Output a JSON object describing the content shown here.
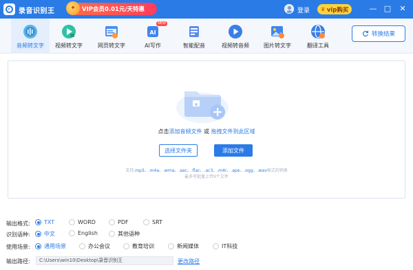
{
  "app": {
    "title": "录音识别王",
    "promo_text": "VIP会员0.01元/天特惠",
    "login": "登录",
    "vip_buy": "vip购买",
    "window_controls": [
      "—",
      "□",
      "✕"
    ]
  },
  "toolbar": {
    "tools": [
      {
        "label": "音频转文字",
        "icon": "audio-to-text-icon",
        "active": true
      },
      {
        "label": "视频转文字",
        "icon": "video-to-text-icon"
      },
      {
        "label": "网页转文字",
        "icon": "webpage-to-text-icon"
      },
      {
        "label": "AI写作",
        "icon": "ai-writing-icon",
        "badge": "NEW"
      },
      {
        "label": "智能配音",
        "icon": "smart-dubbing-icon"
      },
      {
        "label": "视频转音频",
        "icon": "video-to-audio-icon"
      },
      {
        "label": "图片转文字",
        "icon": "image-to-text-icon"
      },
      {
        "label": "翻译工具",
        "icon": "translate-icon"
      }
    ],
    "convert_result": "转换结果"
  },
  "dropzone": {
    "hint_prefix": "点击",
    "hint_add": "添加音频文件",
    "hint_or": " 或 ",
    "hint_drag": "拖拽文件到此区域",
    "select_folder": "选择文件夹",
    "add_file": "添加文件",
    "formats_prefix": "支持",
    "formats": ".mp3、.m4a、.wma、.aac、.flac、.ac3、.m4r、.ape、.ogg、.wav",
    "formats_suffix": "格式的转换",
    "batch_note": "最多可批量上传9个文件"
  },
  "settings": {
    "output_format": {
      "label": "输出格式:",
      "options": [
        "TXT",
        "WORD",
        "PDF",
        "SRT"
      ],
      "selected": 0
    },
    "language": {
      "label": "识别语种:",
      "options": [
        "中文",
        "English",
        "其他语种"
      ],
      "selected": 0
    },
    "scene": {
      "label": "使用场景:",
      "options": [
        "通用场景",
        "办公会议",
        "教育培训",
        "新闻媒体",
        "IT科技"
      ],
      "selected": 0
    },
    "output_path": {
      "label": "输出路径:",
      "value": "C:\\Users\\win10\\Desktop\\录音识别王",
      "change": "更改路径"
    }
  },
  "colors": {
    "accent": "#2a7be6",
    "titlebar": "#2a7be6",
    "vip": "#ffd43b"
  }
}
